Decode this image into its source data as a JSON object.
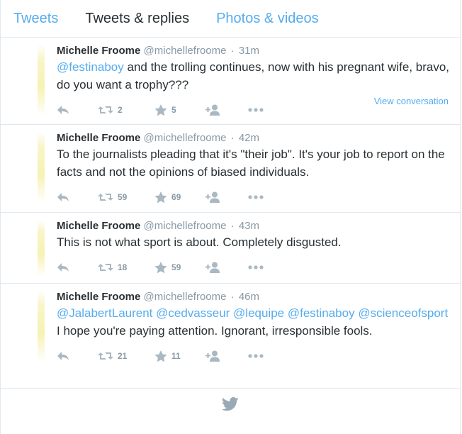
{
  "tabs": [
    {
      "label": "Tweets",
      "active": false
    },
    {
      "label": "Tweets & replies",
      "active": true
    },
    {
      "label": "Photos & videos",
      "active": false
    }
  ],
  "tweets": [
    {
      "name": "Michelle Froome",
      "handle": "@michellefroome",
      "sep": "·",
      "time": "31m",
      "mention": "@festinaboy",
      "text": " and the trolling continues, now with his pregnant wife, bravo, do you want a trophy???",
      "retweets": "2",
      "favorites": "5",
      "view_conversation": "View conversation"
    },
    {
      "name": "Michelle Froome",
      "handle": "@michellefroome",
      "sep": "·",
      "time": "42m",
      "text": "To the journalists pleading that it's \"their job\". It's your job to report on the facts and not the opinions of biased individuals.",
      "retweets": "59",
      "favorites": "69"
    },
    {
      "name": "Michelle Froome",
      "handle": "@michellefroome",
      "sep": "·",
      "time": "43m",
      "text": "This is not what sport is about. Completely disgusted.",
      "retweets": "18",
      "favorites": "59"
    },
    {
      "name": "Michelle Froome",
      "handle": "@michellefroome",
      "sep": "·",
      "time": "46m",
      "mentions": "@JalabertLaurent @cedvasseur @lequipe @festinaboy @scienceofsport",
      "text": " I hope you're paying attention. Ignorant, irresponsible fools.",
      "retweets": "21",
      "favorites": "11"
    }
  ],
  "icons": {
    "reply": "reply-icon",
    "retweet": "retweet-icon",
    "favorite": "star-icon",
    "follow": "follow-icon",
    "more": "more-icon",
    "footer": "twitter-bird-icon"
  },
  "colors": {
    "accent": "#55acee",
    "muted": "#8899a6",
    "icon": "#aab8c2",
    "border": "#e1e8ed"
  }
}
